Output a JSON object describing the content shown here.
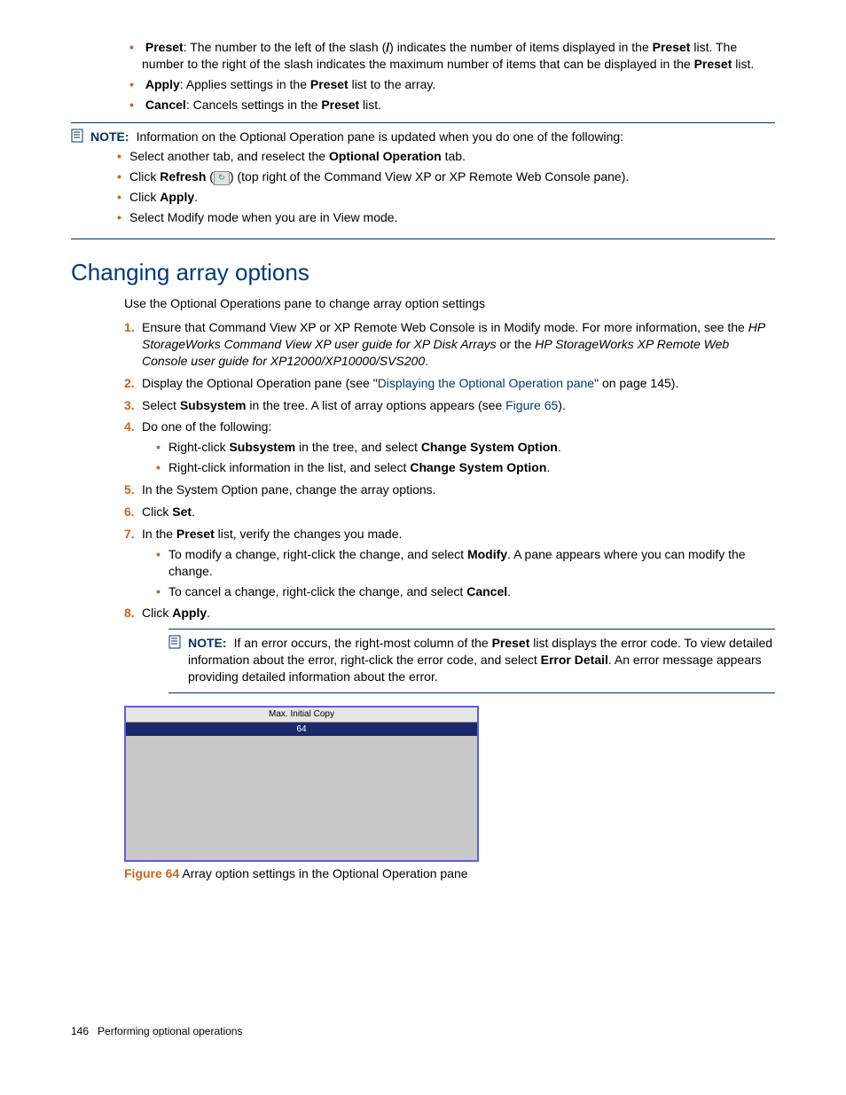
{
  "top_bullets": {
    "preset": {
      "label": "Preset",
      "sep": ": The number to the left of the slash (",
      "slash": "/",
      "rest": ") indicates the number of items displayed in the ",
      "preset2": "Preset",
      "rest2": " list. The number to the right of the slash indicates the maximum number of items that can be displayed in the ",
      "preset3": "Preset",
      "rest3": " list."
    },
    "apply": {
      "label": "Apply",
      "txt1": ": Applies settings in the ",
      "preset": "Preset",
      "txt2": " list to the array."
    },
    "cancel": {
      "label": "Cancel",
      "txt1": ": Cancels settings in the ",
      "preset": "Preset",
      "txt2": " list."
    }
  },
  "note1": {
    "label": "NOTE:",
    "text": "Information on the Optional Operation pane is updated when you do one of the following:",
    "b1a": "Select another tab, and reselect the ",
    "b1b": "Optional Operation",
    "b1c": " tab.",
    "b2a": "Click ",
    "b2b": "Refresh",
    "b2c": " (",
    "b2d": ") (top right of the Command View XP or XP Remote Web Console pane).",
    "b3a": "Click ",
    "b3b": "Apply",
    "b3c": ".",
    "b4": "Select Modify mode when you are in View mode."
  },
  "heading": "Changing array options",
  "intro": "Use the Optional Operations pane to change array option settings",
  "steps": {
    "s1a": "Ensure that Command View XP or XP Remote Web Console is in Modify mode. For more information, see the ",
    "s1i1": "HP StorageWorks Command View XP user guide for XP Disk Arrays",
    "s1b": " or the ",
    "s1i2": "HP StorageWorks XP Remote Web Console user guide for XP12000/XP10000/SVS200",
    "s1c": ".",
    "s2a": "Display the Optional Operation pane (see \"",
    "s2link": "Displaying the Optional Operation pane",
    "s2b": "\" on page 145).",
    "s3a": "Select ",
    "s3b": "Subsystem",
    "s3c": " in the tree. A list of array options appears (see ",
    "s3link": "Figure 65",
    "s3d": ").",
    "s4": "Do one of the following:",
    "s4_1a": "Right-click ",
    "s4_1b": "Subsystem",
    "s4_1c": " in the tree, and select ",
    "s4_1d": "Change System Option",
    "s4_1e": ".",
    "s4_2a": "Right-click information in the list, and select ",
    "s4_2b": "Change System Option",
    "s4_2c": ".",
    "s5": "In the System Option pane, change the array options.",
    "s6a": "Click ",
    "s6b": "Set",
    "s6c": ".",
    "s7a": "In the ",
    "s7b": "Preset",
    "s7c": " list, verify the changes you made.",
    "s7_1a": "To modify a change, right-click the change, and select ",
    "s7_1b": "Modify",
    "s7_1c": ". A pane appears where you can modify the change.",
    "s7_2a": "To cancel a change, right-click the change, and select ",
    "s7_2b": "Cancel",
    "s7_2c": ".",
    "s8a": "Click ",
    "s8b": "Apply",
    "s8c": "."
  },
  "note2": {
    "label": "NOTE:",
    "a": "If an error occurs, the right-most column of the ",
    "b": "Preset",
    "c": " list displays the error code. To view detailed information about the error, right-click the error code, and select ",
    "d": "Error Detail",
    "e": ". An error message appears providing detailed information about the error."
  },
  "figure": {
    "header": "Max. Initial Copy",
    "value": "64",
    "caption_label": "Figure 64",
    "caption_text": "  Array option settings in the Optional Operation pane"
  },
  "footer": {
    "page": "146",
    "text": "Performing optional operations"
  },
  "numbers": {
    "n1": "1.",
    "n2": "2.",
    "n3": "3.",
    "n4": "4.",
    "n5": "5.",
    "n6": "6.",
    "n7": "7.",
    "n8": "8."
  }
}
